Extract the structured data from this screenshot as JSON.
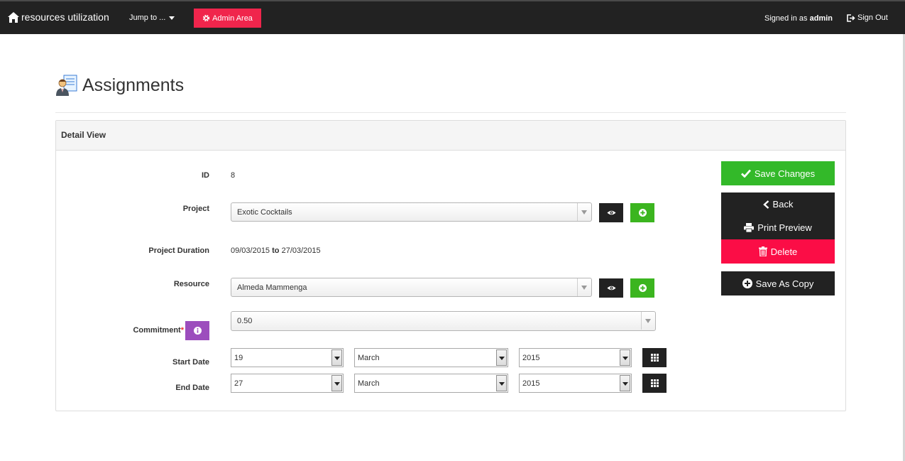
{
  "navbar": {
    "brand": "resources utilization",
    "jump_label": "Jump to ...",
    "admin_label": "Admin Area",
    "signed_prefix": "Signed in as",
    "signed_user": "admin",
    "signout_label": "Sign Out"
  },
  "page": {
    "title": "Assignments"
  },
  "panel": {
    "heading": "Detail View"
  },
  "fields": {
    "id": {
      "label": "ID",
      "value": "8"
    },
    "project": {
      "label": "Project",
      "value": "Exotic Cocktails"
    },
    "duration": {
      "label": "Project Duration",
      "start": "09/03/2015",
      "to": "to",
      "end": "27/03/2015"
    },
    "resource": {
      "label": "Resource",
      "value": "Almeda Mammenga"
    },
    "commitment": {
      "label": "Commitment",
      "required_mark": "*",
      "value": "0.50"
    },
    "start_date": {
      "label": "Start Date",
      "day": "19",
      "month": "March",
      "year": "2015"
    },
    "end_date": {
      "label": "End Date",
      "day": "27",
      "month": "March",
      "year": "2015"
    }
  },
  "actions": {
    "save": "Save Changes",
    "back": "Back",
    "print": "Print Preview",
    "delete": "Delete",
    "save_copy": "Save As Copy"
  },
  "colors": {
    "navbar": "#222222",
    "admin": "#f0254c",
    "green": "#3bb51f",
    "save": "#33b929",
    "dark": "#222222",
    "delete": "#fb0d46",
    "info": "#9c4dbd"
  }
}
